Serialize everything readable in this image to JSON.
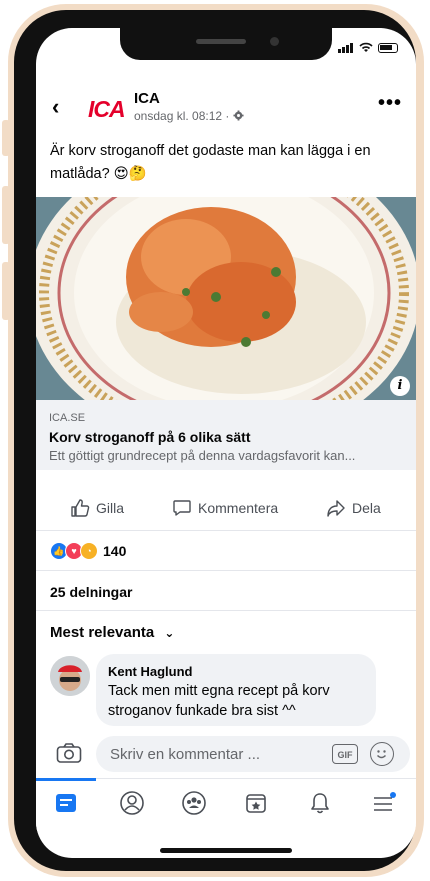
{
  "page": {
    "name": "ICA",
    "timestamp": "onsdag kl. 08:12 ·",
    "text": "Är korv stroganoff det godaste man kan lägga i en matlåda? 😍🤔"
  },
  "link": {
    "domain": "ICA.SE",
    "title": "Korv stroganoff på 6 olika sätt",
    "description": "Ett göttigt grundrecept på denna vardagsfavorit kan..."
  },
  "actions": {
    "like": "Gilla",
    "comment": "Kommentera",
    "share": "Dela"
  },
  "reactions": {
    "count": "140"
  },
  "shares": "25 delningar",
  "comments_filter": "Mest relevanta",
  "comment": {
    "author": "Kent Haglund",
    "text": "Tack men mitt egna recept på korv stroganov funkade bra sist ^^"
  },
  "composer": {
    "placeholder": "Skriv en kommentar ...",
    "gif": "GIF"
  },
  "logo_text": "ICA",
  "colors": {
    "brand_red": "#e4002b",
    "facebook_blue": "#1877f2"
  }
}
